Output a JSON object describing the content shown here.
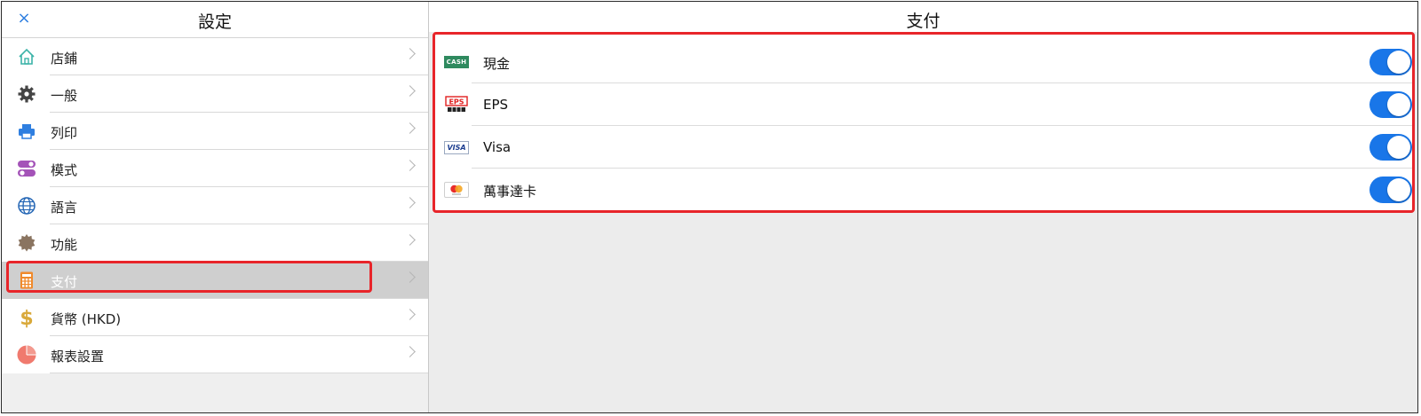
{
  "sidebar": {
    "title": "設定",
    "close_icon": "×",
    "items": [
      {
        "label": "店鋪",
        "icon": "home-icon"
      },
      {
        "label": "一般",
        "icon": "gear-icon"
      },
      {
        "label": "列印",
        "icon": "printer-icon"
      },
      {
        "label": "模式",
        "icon": "toggles-icon"
      },
      {
        "label": "語言",
        "icon": "globe-icon"
      },
      {
        "label": "功能",
        "icon": "badge-icon"
      },
      {
        "label": "支付",
        "icon": "calculator-icon",
        "selected": true
      },
      {
        "label": "貨幣 (HKD)",
        "icon": "dollar-icon"
      },
      {
        "label": "報表設置",
        "icon": "pie-chart-icon"
      }
    ]
  },
  "main": {
    "title": "支付",
    "payments": [
      {
        "label": "現金",
        "icon": "cash-icon",
        "badge": "CASH",
        "enabled": true
      },
      {
        "label": "EPS",
        "icon": "eps-icon",
        "badge": "EPS",
        "enabled": true
      },
      {
        "label": "Visa",
        "icon": "visa-icon",
        "badge": "VISA",
        "enabled": true
      },
      {
        "label": "萬事達卡",
        "icon": "mastercard-icon",
        "enabled": true
      }
    ]
  },
  "colors": {
    "accent": "#1976e8",
    "highlight": "#e8252a",
    "selected_row": "#cfcfcf"
  }
}
